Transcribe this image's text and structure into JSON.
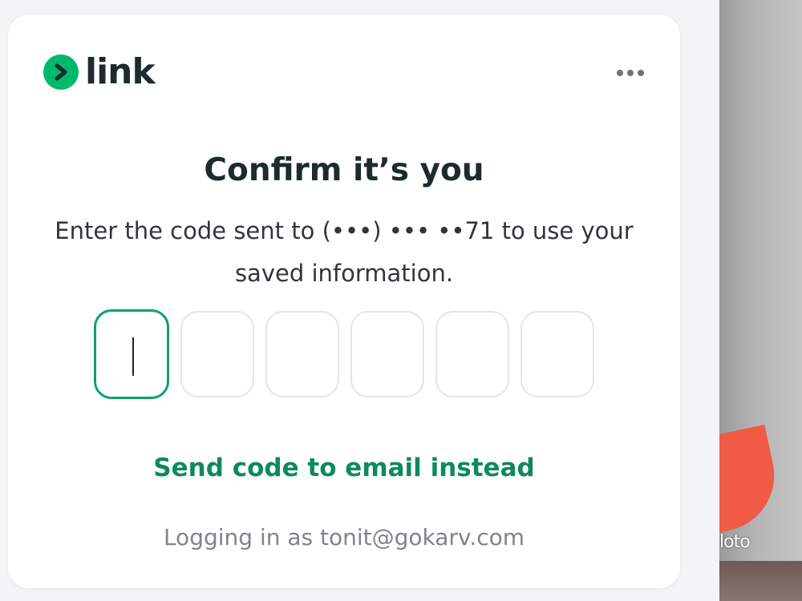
{
  "brand": {
    "name": "link",
    "logo_icon": "chevron-right-icon",
    "accent_color": "#00b86b"
  },
  "menu": {
    "icon": "more-horizontal-icon"
  },
  "verification": {
    "title": "Confirm it’s you",
    "subtitle_line1": "Enter the code sent to (•••) ••• ••71 to use your",
    "subtitle_line2": "saved information.",
    "code_digits": [
      "",
      "",
      "",
      "",
      "",
      ""
    ],
    "active_digit_index": 0,
    "alternate_link": "Send code to email instead",
    "logged_in_as": "Logging in as tonit@gokarv.com"
  },
  "background_photo": {
    "caption_fragment": "loto"
  },
  "colors": {
    "title": "#1d2b2d",
    "link": "#0d8a5c",
    "active_border": "#0fa16a",
    "muted_text": "#7d8589"
  }
}
